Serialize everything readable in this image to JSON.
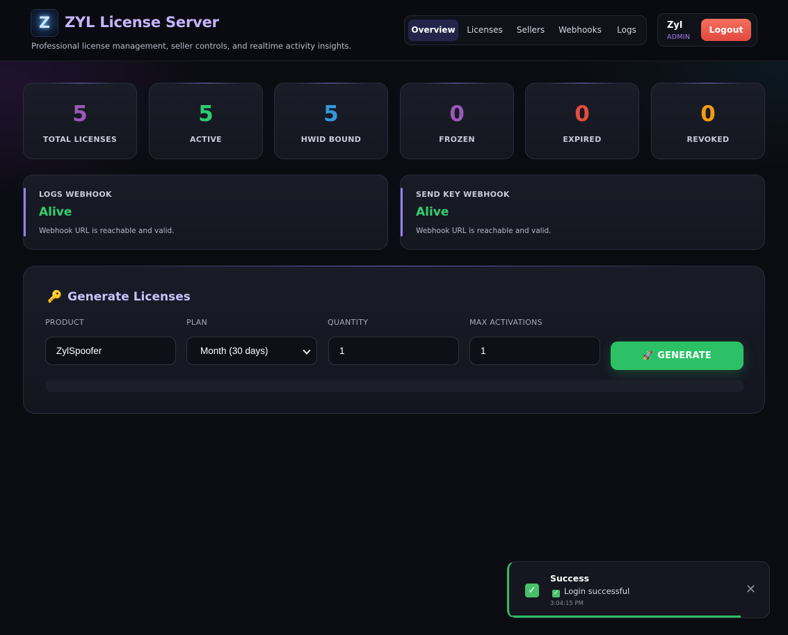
{
  "header": {
    "logo_letter": "Z",
    "title": "ZYL License Server",
    "subtitle": "Professional license management, seller controls, and realtime activity insights.",
    "nav": [
      {
        "label": "Overview",
        "active": true
      },
      {
        "label": "Licenses",
        "active": false
      },
      {
        "label": "Sellers",
        "active": false
      },
      {
        "label": "Webhooks",
        "active": false
      },
      {
        "label": "Logs",
        "active": false
      }
    ],
    "user": {
      "name": "Zyl",
      "role": "ADMIN",
      "logout_label": "Logout"
    }
  },
  "stats": [
    {
      "value": "5",
      "label": "TOTAL LICENSES",
      "color": "#9b59b6"
    },
    {
      "value": "5",
      "label": "ACTIVE",
      "color": "#2ecc71"
    },
    {
      "value": "5",
      "label": "HWID BOUND",
      "color": "#3498db"
    },
    {
      "value": "0",
      "label": "FROZEN",
      "color": "#9b59b6"
    },
    {
      "value": "0",
      "label": "EXPIRED",
      "color": "#e74c3c"
    },
    {
      "value": "0",
      "label": "REVOKED",
      "color": "#f39c12"
    }
  ],
  "webhooks": [
    {
      "title": "LOGS WEBHOOK",
      "status": "Alive",
      "description": "Webhook URL is reachable and valid."
    },
    {
      "title": "SEND KEY WEBHOOK",
      "status": "Alive",
      "description": "Webhook URL is reachable and valid."
    }
  ],
  "generate": {
    "title": "Generate Licenses",
    "icon": "key-icon",
    "product_label": "PRODUCT",
    "product_value": "ZylSpoofer",
    "plan_label": "PLAN",
    "plan_value": "Month (30 days)",
    "quantity_label": "QUANTITY",
    "quantity_value": "1",
    "max_activations_label": "MAX ACTIVATIONS",
    "max_activations_value": "1",
    "button_label": "GENERATE"
  },
  "toast": {
    "title": "Success",
    "message": "Login successful",
    "time": "3:04:15 PM",
    "progress": 0.89
  },
  "colors": {
    "accent": "#c6b3ff",
    "success": "#2cc166",
    "danger": "#e2493f"
  }
}
